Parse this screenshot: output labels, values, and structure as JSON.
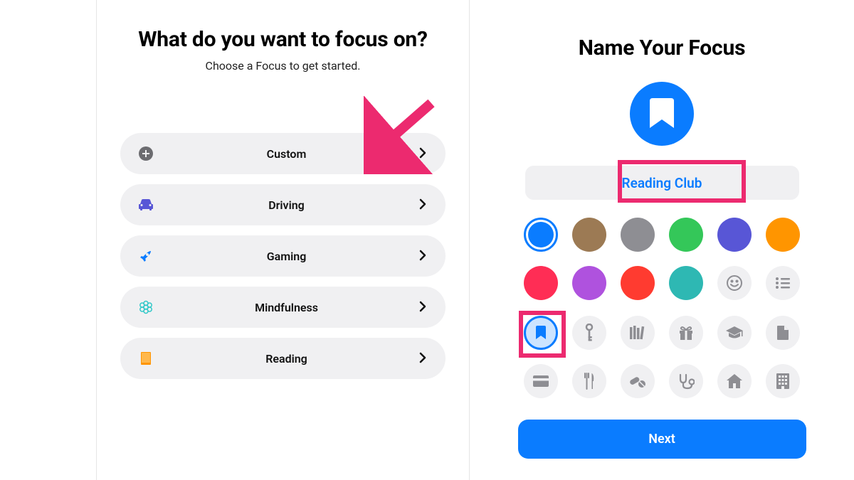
{
  "left": {
    "title": "What do you want to focus on?",
    "subtitle": "Choose a Focus to get started.",
    "items": [
      {
        "id": "custom",
        "label": "Custom",
        "icon": "plus-circle-icon",
        "color": "#666666"
      },
      {
        "id": "driving",
        "label": "Driving",
        "icon": "car-icon",
        "color": "#5856d6"
      },
      {
        "id": "gaming",
        "label": "Gaming",
        "icon": "rocket-icon",
        "color": "#0a7cff"
      },
      {
        "id": "mindfulness",
        "label": "Mindfulness",
        "icon": "flower-icon",
        "color": "#31c8c8"
      },
      {
        "id": "reading",
        "label": "Reading",
        "icon": "book-icon",
        "color": "#ff9500"
      }
    ]
  },
  "right": {
    "title": "Name Your Focus",
    "name_value": "Reading Club",
    "hero_color": "#0a7cff",
    "colors": [
      {
        "hex": "#0a7cff",
        "selected": true
      },
      {
        "hex": "#9c7a54",
        "selected": false
      },
      {
        "hex": "#8e8e93",
        "selected": false
      },
      {
        "hex": "#34c759",
        "selected": false
      },
      {
        "hex": "#5856d6",
        "selected": false
      },
      {
        "hex": "#ff9500",
        "selected": false
      },
      {
        "hex": "#ff2d55",
        "selected": false
      },
      {
        "hex": "#af52de",
        "selected": false
      },
      {
        "hex": "#ff3b30",
        "selected": false
      },
      {
        "hex": "#2eb8b3",
        "selected": false
      },
      {
        "id": "emoji",
        "special": "emoji"
      },
      {
        "id": "list",
        "special": "list"
      }
    ],
    "icons": [
      {
        "id": "bookmark",
        "selected": true
      },
      {
        "id": "key"
      },
      {
        "id": "books"
      },
      {
        "id": "gift"
      },
      {
        "id": "graduation"
      },
      {
        "id": "file"
      },
      {
        "id": "creditcard"
      },
      {
        "id": "fork-knife"
      },
      {
        "id": "pills"
      },
      {
        "id": "stethoscope"
      },
      {
        "id": "house"
      },
      {
        "id": "building"
      }
    ],
    "next_label": "Next"
  },
  "annotations": {
    "arrow_color": "#ec2a6f"
  }
}
